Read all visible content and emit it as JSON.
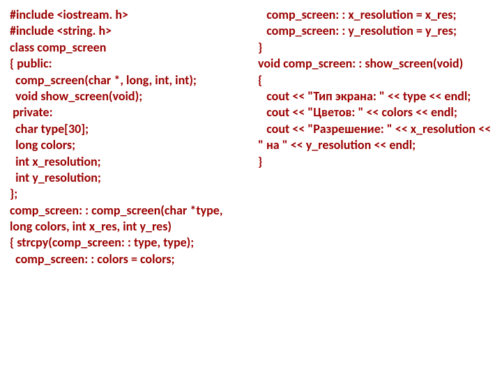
{
  "left": [
    {
      "pre": "",
      "text": "#include <iostream. h>"
    },
    {
      "pre": "",
      "text": "#include <string. h>"
    },
    {
      "pre": "",
      "text": "class comp_screen"
    },
    {
      "pre": "",
      "text": "{ public:"
    },
    {
      "pre": "  ",
      "text": "comp_screen(char *, long, int, int);"
    },
    {
      "pre": "  ",
      "text": "void show_screen(void);"
    },
    {
      "pre": " ",
      "text": "private:"
    },
    {
      "pre": "  ",
      "text": "char type[30];"
    },
    {
      "pre": "  ",
      "text": "long colors;"
    },
    {
      "pre": "  ",
      "text": "int x_resolution;"
    },
    {
      "pre": "  ",
      "text": "int y_resolution;"
    },
    {
      "pre": "",
      "text": "};"
    },
    {
      "pre": "",
      "text": "comp_screen: : comp_screen(char *type, long colors, int x_res, int y_res)"
    },
    {
      "pre": "",
      "text": "{ strcpy(comp_screen: : type, type);"
    },
    {
      "pre": "  ",
      "text": "comp_screen: : colors = colors;"
    }
  ],
  "right": [
    {
      "pre": "   ",
      "text": "comp_screen: : x_resolution = x_res;"
    },
    {
      "pre": "   ",
      "text": "comp_screen: : y_resolution = y_res;"
    },
    {
      "pre": "",
      "text": "}"
    },
    {
      "pre": "",
      "text": "void comp_screen: : show_screen(void)"
    },
    {
      "pre": "",
      "text": "{"
    },
    {
      "pre": "   ",
      "text": "cout << \"Тип экрана: \" << type << endl;",
      "wrap": true,
      "wrapIndent": ""
    },
    {
      "pre": "   ",
      "text": "cout << \"Цветов: \" << colors << endl;"
    },
    {
      "pre": "   ",
      "text": "cout << \"Разрешение: \" << x_resolution << \" на \" << y_resolution << endl;",
      "wrap": true,
      "wrapIndent": ""
    },
    {
      "pre": "",
      "text": "}"
    }
  ]
}
